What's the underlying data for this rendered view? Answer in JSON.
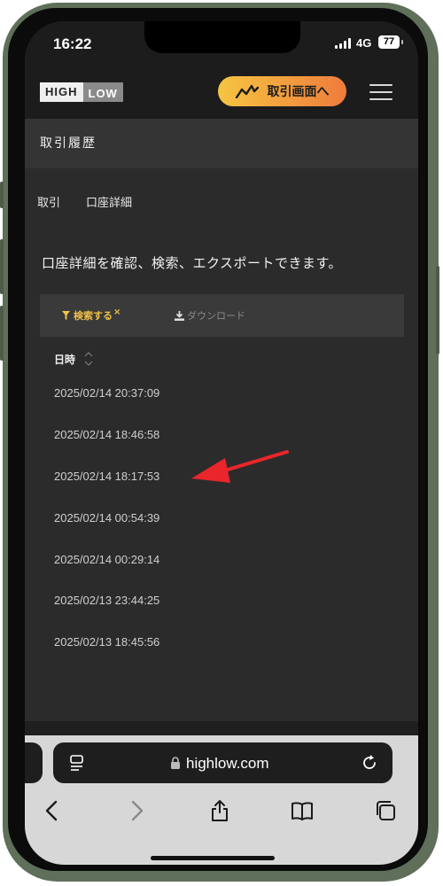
{
  "status_bar": {
    "time": "16:22",
    "network": "4G",
    "battery": "77"
  },
  "header": {
    "logo_high": "HIGH",
    "logo_low": "LOW",
    "trade_button_label": "取引画面へ"
  },
  "page_title": "取引履歴",
  "tabs": [
    {
      "label": "取引"
    },
    {
      "label": "口座詳細"
    }
  ],
  "description": "口座詳細を確認、検索、エクスポートできます。",
  "toolbar": {
    "filter_label": "検索する",
    "filter_clear": "×",
    "download_label": "ダウンロード"
  },
  "table": {
    "column_header": "日時",
    "rows": [
      "2025/02/14 20:37:09",
      "2025/02/14 18:46:58",
      "2025/02/14 18:17:53",
      "2025/02/14 00:54:39",
      "2025/02/14 00:29:14",
      "2025/02/13 23:44:25",
      "2025/02/13 18:45:56"
    ]
  },
  "browser": {
    "url": "highlow.com"
  },
  "colors": {
    "accent_gold": "#f0c24b",
    "button_gradient_start": "#f5c542",
    "button_gradient_end": "#ef7b3c",
    "annotation_arrow": "#e8262b"
  },
  "icons": {
    "filter": "funnel-icon",
    "download": "download-icon",
    "sort": "sort-icon",
    "menu": "hamburger-icon",
    "trade": "chart-line-icon",
    "nav": [
      "back-icon",
      "forward-icon",
      "share-icon",
      "bookmarks-icon",
      "tabs-icon"
    ]
  }
}
